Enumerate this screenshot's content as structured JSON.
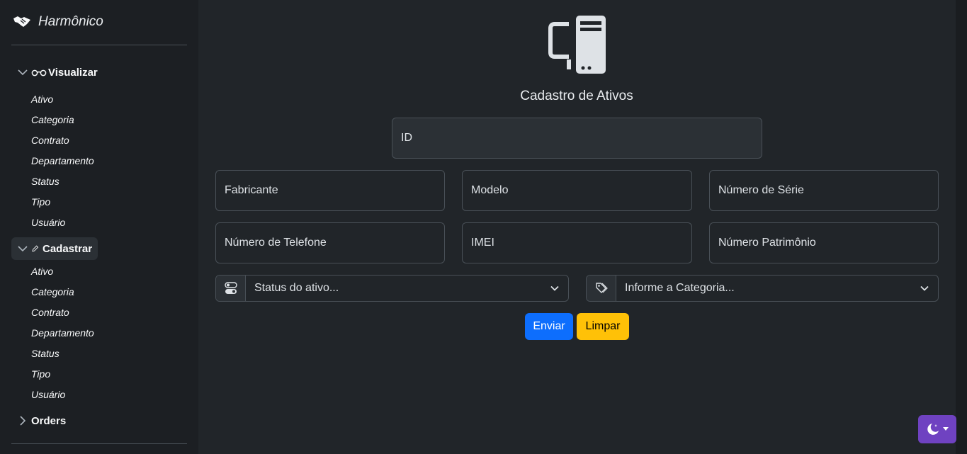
{
  "sidebar": {
    "brand": "Harmônico",
    "visualizar": {
      "label": "Visualizar",
      "items": [
        "Ativo",
        "Categoria",
        "Contrato",
        "Departamento",
        "Status",
        "Tipo",
        "Usuário"
      ]
    },
    "cadastrar": {
      "label": "Cadastrar",
      "items": [
        "Ativo",
        "Categoria",
        "Contrato",
        "Departamento",
        "Status",
        "Tipo",
        "Usuário"
      ]
    },
    "orders": {
      "label": "Orders"
    }
  },
  "form": {
    "title": "Cadastro de Ativos",
    "fields": {
      "id": "ID",
      "fabricante": "Fabricante",
      "modelo": "Modelo",
      "numero_serie": "Número de Série",
      "numero_telefone": "Número de Telefone",
      "imei": "IMEI",
      "numero_patrimonio": "Número Patrimônio"
    },
    "selects": {
      "status": "Status do ativo...",
      "categoria": "Informe a Categoria..."
    },
    "buttons": {
      "submit": "Enviar",
      "clear": "Limpar"
    }
  },
  "icons": {
    "brand": "handshake-icon",
    "visualizar": "glasses-icon",
    "cadastrar": "pencil-icon",
    "pc": "pc-display-icon",
    "status": "toggles-icon",
    "categoria": "tags-icon",
    "theme": "moon-stars-icon"
  },
  "colors": {
    "primary": "#0d6efd",
    "warning": "#ffc107",
    "theme_toggle": "#6f42c1",
    "background": "#212529"
  }
}
